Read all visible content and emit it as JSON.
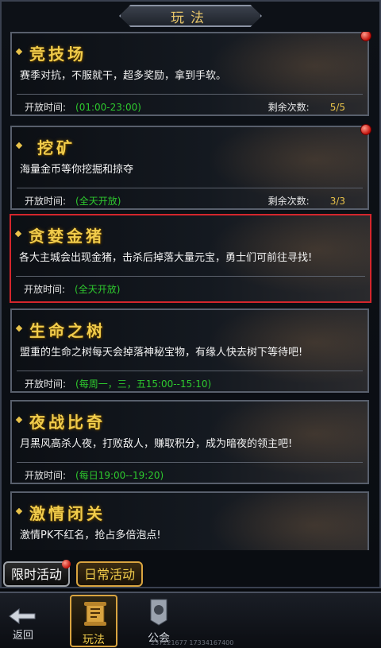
{
  "header": {
    "title": "玩法"
  },
  "labels": {
    "open_time": "开放时间:",
    "remaining": "剩余次数:"
  },
  "cards": [
    {
      "title": "竞技场",
      "desc": "赛季对抗，不服就干，超多奖励，拿到手软。",
      "time": "(01:00-23:00)",
      "count": "5/5",
      "has_badge": true
    },
    {
      "title": "挖矿",
      "desc": "海量金币等你挖掘和掠夺",
      "time": "(全天开放)",
      "count": "3/3",
      "has_badge": true
    },
    {
      "title": "贪婪金猪",
      "desc": "各大主城会出现金猪，击杀后掉落大量元宝，勇士们可前往寻找!",
      "time": "(全天开放)",
      "selected": true
    },
    {
      "title": "生命之树",
      "desc": "盟重的生命之树每天会掉落神秘宝物，有缘人快去树下等待吧!",
      "time": "(每周一，三，五15:00--15:10)"
    },
    {
      "title": "夜战比奇",
      "desc": "月黑风高杀人夜，打败敌人，赚取积分，成为暗夜的领主吧!",
      "time": "(每日19:00--19:20)"
    },
    {
      "title": "激情闭关",
      "desc": "激情PK不红名，抢占多倍泡点!"
    }
  ],
  "tabs": {
    "limited": "限时活动",
    "daily": "日常活动"
  },
  "bottom_nav": {
    "back": "返回",
    "play": "玩法",
    "guild": "公会"
  },
  "footer_text": "237221677 17334167400",
  "colors": {
    "gold": "#f1cc4b",
    "green": "#2ec92e",
    "selected_border": "#d4262c",
    "badge": "#c1120b"
  }
}
